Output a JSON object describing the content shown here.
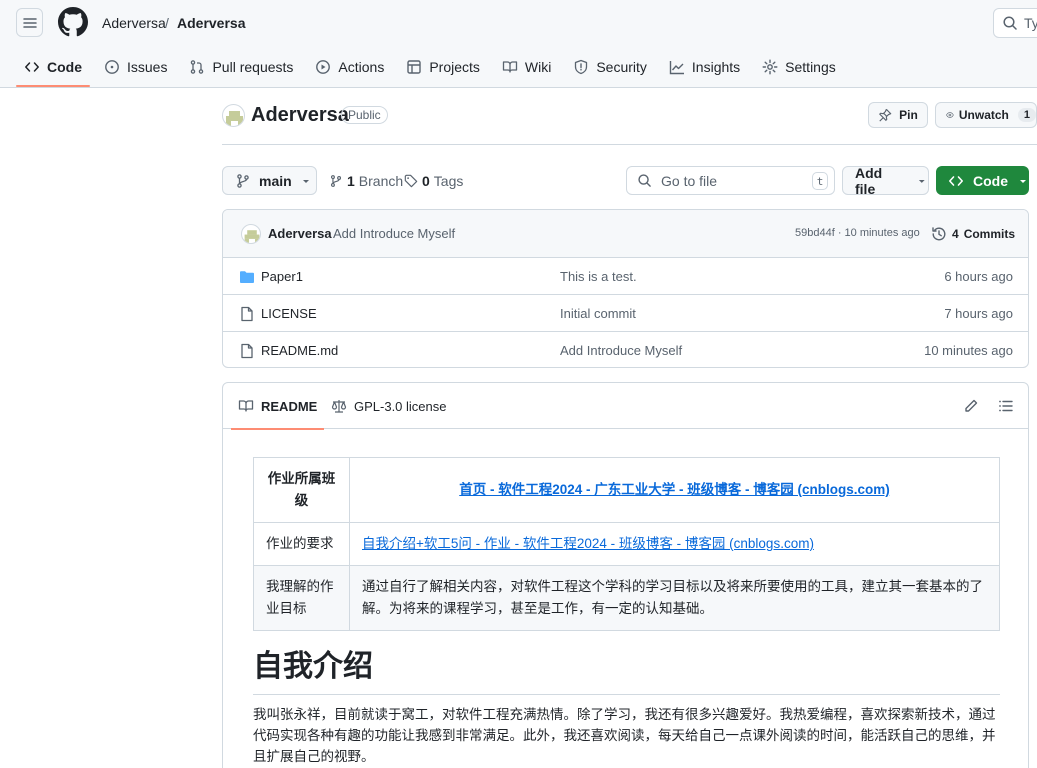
{
  "header": {
    "owner": "Aderversa",
    "separator": "/",
    "repo": "Aderversa",
    "search_text": "Typ"
  },
  "nav": {
    "tabs": [
      {
        "label": "Code",
        "icon": "code-icon"
      },
      {
        "label": "Issues",
        "icon": "issue-icon"
      },
      {
        "label": "Pull requests",
        "icon": "pull-request-icon"
      },
      {
        "label": "Actions",
        "icon": "play-icon"
      },
      {
        "label": "Projects",
        "icon": "table-icon"
      },
      {
        "label": "Wiki",
        "icon": "book-icon"
      },
      {
        "label": "Security",
        "icon": "shield-icon"
      },
      {
        "label": "Insights",
        "icon": "graph-icon"
      },
      {
        "label": "Settings",
        "icon": "gear-icon"
      }
    ]
  },
  "repo": {
    "name": "Aderversa",
    "visibility": "Public",
    "pin_label": "Pin",
    "watch_label": "Unwatch",
    "watch_count": "1"
  },
  "toolbar": {
    "branch": "main",
    "branch_count": "1",
    "branch_word": "Branch",
    "tag_count": "0",
    "tag_word": "Tags",
    "goto_placeholder": "Go to file",
    "goto_key": "t",
    "add_file": "Add file",
    "code": "Code"
  },
  "latest_commit": {
    "author": "Aderversa",
    "message": "Add Introduce Myself",
    "meta": "59bd44f · 10 minutes ago",
    "commits_count": "4",
    "commits_word": "Commits"
  },
  "files": [
    {
      "name": "Paper1",
      "type": "folder",
      "commit": "This is a test.",
      "time": "6 hours ago"
    },
    {
      "name": "LICENSE",
      "type": "file",
      "commit": "Initial commit",
      "time": "7 hours ago"
    },
    {
      "name": "README.md",
      "type": "file",
      "commit": "Add Introduce Myself",
      "time": "10 minutes ago"
    }
  ],
  "readme": {
    "tab_readme": "README",
    "tab_license": "GPL-3.0 license",
    "table": [
      {
        "key": "作业所属班级",
        "value": "首页 - 软件工程2024 - 广东工业大学 - 班级博客 - 博客园 (cnblogs.com)",
        "link": true
      },
      {
        "key": "作业的要求",
        "value": "自我介绍+软工5问 - 作业 - 软件工程2024 - 班级博客 - 博客园 (cnblogs.com)",
        "link": true
      },
      {
        "key": "我理解的作业目标",
        "value": "通过自行了解相关内容，对软件工程这个学科的学习目标以及将来所要使用的工具，建立其一套基本的了解。为将来的课程学习，甚至是工作，有一定的认知基础。",
        "link": false
      }
    ],
    "heading": "自我介绍",
    "paragraph": "我叫张永祥，目前就读于窝工，对软件工程充满热情。除了学习，我还有很多兴趣爱好。我热爱编程，喜欢探索新技术，通过代码实现各种有趣的功能让我感到非常满足。此外，我还喜欢阅读，每天给自己一点课外阅读的时间，能活跃自己的思维，并且扩展自己的视野。"
  },
  "colors": {
    "accent_underline": "#fd8c73",
    "code_button": "#1f883d",
    "link": "#0969da",
    "folder": "#54aeff"
  }
}
